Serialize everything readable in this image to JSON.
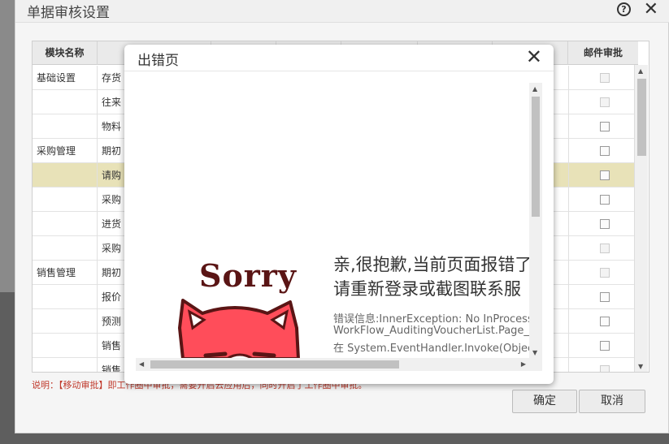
{
  "outer": {
    "title": "单据审核设置",
    "help_glyph": "?",
    "close_glyph": "✕",
    "columns": {
      "module": "模块名称",
      "mail": "邮件审批"
    },
    "rows": [
      {
        "module": "基础设置",
        "name": "存货",
        "mail_enabled": false,
        "selected": false
      },
      {
        "module": "",
        "name": "往来",
        "mail_enabled": false,
        "selected": false
      },
      {
        "module": "",
        "name": "物料",
        "mail_enabled": true,
        "selected": false
      },
      {
        "module": "采购管理",
        "name": "期初",
        "mail_enabled": true,
        "selected": false
      },
      {
        "module": "",
        "name": "请购",
        "mail_enabled": true,
        "selected": true
      },
      {
        "module": "",
        "name": "采购",
        "mail_enabled": true,
        "selected": false
      },
      {
        "module": "",
        "name": "进货",
        "mail_enabled": true,
        "selected": false
      },
      {
        "module": "",
        "name": "采购",
        "mail_enabled": false,
        "selected": false
      },
      {
        "module": "销售管理",
        "name": "期初",
        "mail_enabled": false,
        "selected": false
      },
      {
        "module": "",
        "name": "报价",
        "mail_enabled": true,
        "selected": false
      },
      {
        "module": "",
        "name": "预测",
        "mail_enabled": true,
        "selected": false
      },
      {
        "module": "",
        "name": "销售",
        "mail_enabled": true,
        "selected": false
      },
      {
        "module": "",
        "name": "销售",
        "mail_enabled": false,
        "selected": false
      }
    ],
    "note": "说明：【移动审批】即工作圈中审批，需要开启云应用后，同时开启了工作圈中审批。",
    "ok_label": "确定",
    "cancel_label": "取消"
  },
  "error_dialog": {
    "title": "出错页",
    "close_glyph": "✕",
    "sorry_word": "Sorry",
    "message_line1": "亲,很抱歉,当前页面报错了",
    "message_line2": "请重新登录或截图联系服",
    "detail_line1": "错误信息:InnerException: No InProcess",
    "detail_line2": "WorkFlow_AuditingVoucherList.Page_Lo",
    "detail_line3": "在 System.EventHandler.Invoke(Object"
  },
  "colors": {
    "selected_row": "#e8e2b8",
    "note_text": "#c0392b",
    "mascot_red": "#ff4d5a",
    "mascot_outline": "#5a1515"
  }
}
